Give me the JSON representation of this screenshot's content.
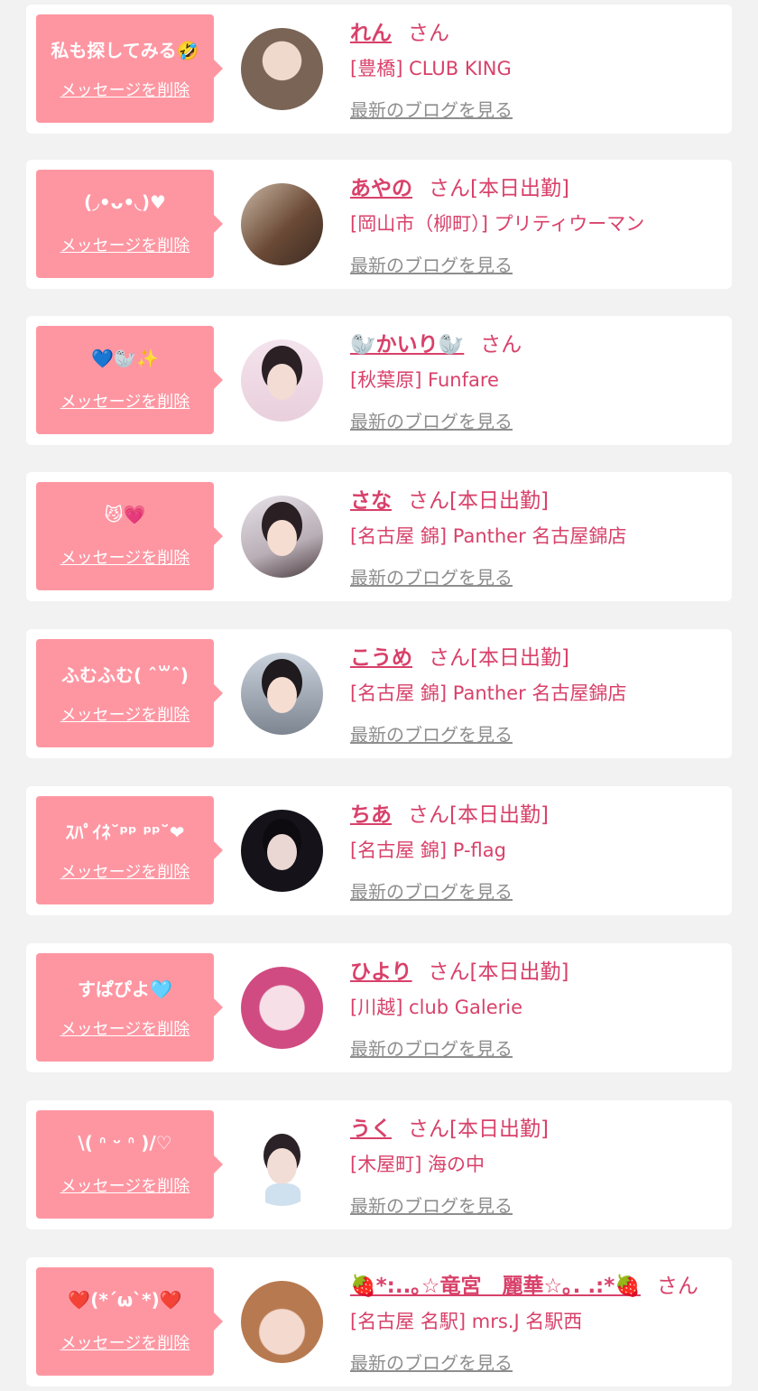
{
  "colors": {
    "accent": "#d8416a",
    "bubble": "#fe96a2",
    "link_gray": "#8e8e8e"
  },
  "common": {
    "delete_label": "メッセージを削除",
    "blog_label": "最新のブログを見る",
    "san": "さん"
  },
  "entries": [
    {
      "message": "私も探してみる🤣",
      "name": "れん",
      "status": "",
      "shop": "[豊橋] CLUB KING"
    },
    {
      "message": "(◞•ᴗ•◟)♥",
      "name": "あやの",
      "status": "[本日出勤]",
      "shop": "[岡山市（柳町）] プリティウーマン"
    },
    {
      "message": "💙🦭✨",
      "name": "🦭かいり🦭",
      "status": "",
      "shop": "[秋葉原] Funfare"
    },
    {
      "message": "😼💗",
      "name": "さな",
      "status": "[本日出勤]",
      "shop": "[名古屋 錦] Panther 名古屋錦店"
    },
    {
      "message": "ふむふむ( ˆ꒳ˆ)",
      "name": "こうめ",
      "status": "[本日出勤]",
      "shop": "[名古屋 錦] Panther 名古屋錦店"
    },
    {
      "message": "ｽﾊﾟｲﾈ˘ᵖᵖ ᵖᵖ˘❤",
      "name": "ちあ",
      "status": "[本日出勤]",
      "shop": "[名古屋 錦] P-flag"
    },
    {
      "message": "すぱぴよ🩵",
      "name": "ひより",
      "status": "[本日出勤]",
      "shop": "[川越] club Galerie"
    },
    {
      "message": "\\( ᐢ ᵕ ᐢ )/♡",
      "name": "うく",
      "status": "[本日出勤]",
      "shop": "[木屋町] 海の中"
    },
    {
      "message": "❤️(*´ω`*)❤️",
      "name": "🍓*:..｡☆竜宮　麗華☆｡. .:*🍓",
      "status": "",
      "shop": "[名古屋 名駅] mrs.J 名駅西"
    }
  ]
}
